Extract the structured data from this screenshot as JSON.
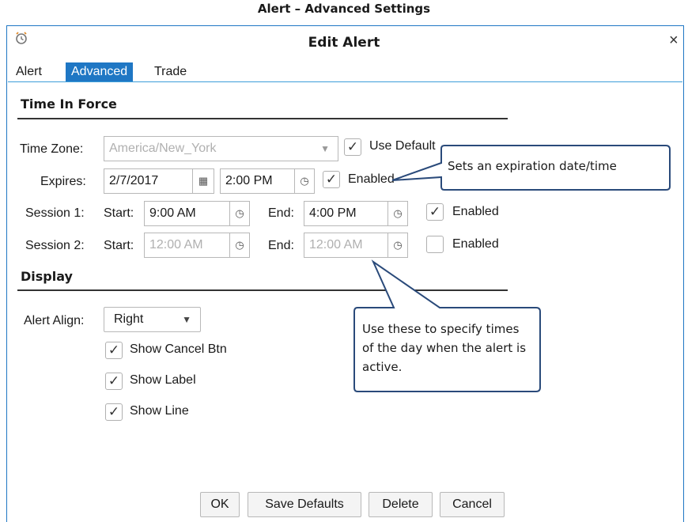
{
  "caption": "Alert – Advanced Settings",
  "dialog": {
    "title": "Edit Alert",
    "close_glyph": "×",
    "icon": "alarm-clock-icon"
  },
  "tabs": [
    {
      "label": "Alert"
    },
    {
      "label": "Advanced"
    },
    {
      "label": "Trade"
    }
  ],
  "time_in_force": {
    "heading": "Time In Force",
    "time_zone_label": "Time Zone:",
    "time_zone_value": "America/New_York",
    "use_default_label": "Use Default",
    "expires_label": "Expires:",
    "expires_date": "2/7/2017",
    "expires_time": "2:00 PM",
    "expires_enabled_label": "Enabled",
    "session1_label": "Session 1:",
    "session1_start_label": "Start:",
    "session1_start": "9:00 AM",
    "session1_end_label": "End:",
    "session1_end": "4:00 PM",
    "session1_enabled_label": "Enabled",
    "session2_label": "Session 2:",
    "session2_start_label": "Start:",
    "session2_start": "12:00 AM",
    "session2_end_label": "End:",
    "session2_end": "12:00 AM",
    "session2_enabled_label": "Enabled"
  },
  "display": {
    "heading": "Display",
    "align_label": "Alert Align:",
    "align_value": "Right",
    "show_cancel_label": "Show Cancel Btn",
    "show_label_label": "Show Label",
    "show_line_label": "Show Line"
  },
  "buttons": {
    "ok": "OK",
    "save_defaults": "Save Defaults",
    "delete": "Delete",
    "cancel": "Cancel"
  },
  "callouts": {
    "expiration": "Sets an expiration date/time",
    "sessions": "Use these to specify times of the day when the alert is active."
  },
  "colors": {
    "accent": "#1f77c4",
    "callout_border": "#2a4a7a"
  }
}
